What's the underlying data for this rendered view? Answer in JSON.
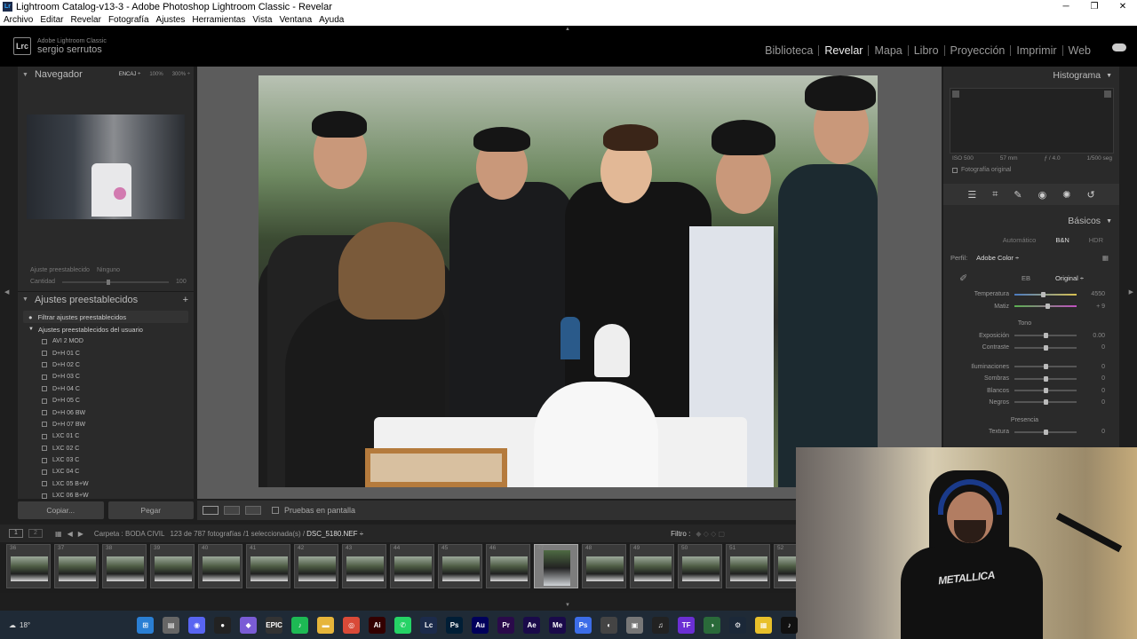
{
  "window": {
    "title": "Lightroom Catalog-v13-3 - Adobe Photoshop Lightroom Classic - Revelar",
    "minimize": "─",
    "maximize": "❐",
    "close": "✕"
  },
  "menu": [
    "Archivo",
    "Editar",
    "Revelar",
    "Fotografía",
    "Ajustes",
    "Herramientas",
    "Vista",
    "Ventana",
    "Ayuda"
  ],
  "identity": {
    "badge": "Lrc",
    "product": "Adobe Lightroom Classic",
    "user": "sergio serrutos"
  },
  "modules": [
    {
      "label": "Biblioteca",
      "active": false
    },
    {
      "label": "Revelar",
      "active": true
    },
    {
      "label": "Mapa",
      "active": false
    },
    {
      "label": "Libro",
      "active": false
    },
    {
      "label": "Proyección",
      "active": false
    },
    {
      "label": "Imprimir",
      "active": false
    },
    {
      "label": "Web",
      "active": false
    }
  ],
  "navigator": {
    "title": "Navegador",
    "opt1": "ENCAJ ÷",
    "opt2": "100%",
    "opt3": "300% ÷"
  },
  "preset_info": {
    "label": "Ajuste preestablecido",
    "value": "Ninguno",
    "amount_label": "Cantidad",
    "amount_value": "100"
  },
  "presets": {
    "title": "Ajustes preestablecidos",
    "add": "+",
    "filter": "Filtrar ajustes preestablecidos",
    "group": "Ajustes preestablecidos del usuario",
    "items": [
      "AVI 2 MOD",
      "D+H 01 C",
      "D+H 02 C",
      "D+H 03 C",
      "D+H 04 C",
      "D+H 05 C",
      "D+H 06 BW",
      "D+H 07 BW",
      "LXC 01 C",
      "LXC 02 C",
      "LXC 03 C",
      "LXC 04 C",
      "LXC 05 B+W",
      "LXC 06 B+W"
    ]
  },
  "left_buttons": {
    "copy": "Copiar...",
    "paste": "Pegar"
  },
  "toolbar": {
    "proof": "Pruebas en pantalla"
  },
  "histogram": {
    "title": "Histograma",
    "iso": "ISO 500",
    "focal": "57 mm",
    "aperture": "ƒ / 4.0",
    "shutter": "1/500 seg",
    "original": "Fotografía original"
  },
  "basic": {
    "title": "Básicos",
    "treatment": [
      "Automático",
      "B&N",
      "HDR"
    ],
    "profile_label": "Perfil:",
    "profile_value": "Adobe Color ÷",
    "wb_label": "EB",
    "wb_value": "Original ÷",
    "temp": {
      "label": "Temperatura",
      "value": "4550",
      "pos": 0.45
    },
    "tint": {
      "label": "Matiz",
      "value": "+ 9",
      "pos": 0.53
    },
    "tone_label": "Tono",
    "tone": [
      {
        "label": "Exposición",
        "value": "0.00",
        "pos": 0.5
      },
      {
        "label": "Contraste",
        "value": "0",
        "pos": 0.5
      }
    ],
    "tone2": [
      {
        "label": "Iluminaciones",
        "value": "0",
        "pos": 0.5
      },
      {
        "label": "Sombras",
        "value": "0",
        "pos": 0.5
      },
      {
        "label": "Blancos",
        "value": "0",
        "pos": 0.5
      },
      {
        "label": "Negros",
        "value": "0",
        "pos": 0.5
      }
    ],
    "presence_label": "Presencia",
    "texture": {
      "label": "Textura",
      "value": "0",
      "pos": 0.5
    }
  },
  "filmbar": {
    "screen1": "1",
    "screen2": "2",
    "folder": "Carpeta : BODA CIVIL",
    "count": "123 de 787 fotografías /1 seleccionada(s) /",
    "file": "DSC_5180.NEF ÷",
    "filter": "Filtro :"
  },
  "filmstrip": [
    "36",
    "37",
    "38",
    "39",
    "40",
    "41",
    "42",
    "43",
    "44",
    "45",
    "46",
    "47",
    "48",
    "49",
    "50",
    "51",
    "52"
  ],
  "selected_frame": "47",
  "taskbar": {
    "temp": "18°",
    "apps": [
      {
        "name": "windows",
        "label": "⊞",
        "color": "#2a7fd4"
      },
      {
        "name": "explorer-files",
        "label": "▤",
        "color": "#666"
      },
      {
        "name": "discord",
        "label": "◉",
        "color": "#5865f2"
      },
      {
        "name": "obs",
        "label": "●",
        "color": "#222"
      },
      {
        "name": "copilot",
        "label": "◆",
        "color": "#7a5cd6"
      },
      {
        "name": "epic",
        "label": "EPIC",
        "color": "#333"
      },
      {
        "name": "spotify",
        "label": "♪",
        "color": "#1db954"
      },
      {
        "name": "folder",
        "label": "▬",
        "color": "#e6b53a"
      },
      {
        "name": "chrome",
        "label": "◎",
        "color": "#d94a38"
      },
      {
        "name": "illustrator",
        "label": "Ai",
        "color": "#330000"
      },
      {
        "name": "whatsapp",
        "label": "✆",
        "color": "#25d366"
      },
      {
        "name": "lightroom",
        "label": "Lc",
        "color": "#1c2b4b"
      },
      {
        "name": "photoshop",
        "label": "Ps",
        "color": "#001e36"
      },
      {
        "name": "audition",
        "label": "Au",
        "color": "#00005b"
      },
      {
        "name": "premiere",
        "label": "Pr",
        "color": "#2a0a4a"
      },
      {
        "name": "after-effects",
        "label": "Ae",
        "color": "#1a0a4a"
      },
      {
        "name": "media-encoder",
        "label": "Me",
        "color": "#1a0a4a"
      },
      {
        "name": "ps-express",
        "label": "Ps",
        "color": "#3c6de8"
      },
      {
        "name": "steam-dl",
        "label": "◐",
        "color": "#444"
      },
      {
        "name": "pdf",
        "label": "▣",
        "color": "#777"
      },
      {
        "name": "tiktok-studio",
        "label": "♫",
        "color": "#222"
      },
      {
        "name": "tf",
        "label": "TF",
        "color": "#6b2fd4"
      },
      {
        "name": "app-green",
        "label": "◑",
        "color": "#2a6a3a"
      },
      {
        "name": "steam",
        "label": "⚙",
        "color": "#1b2838"
      },
      {
        "name": "sticky",
        "label": "▦",
        "color": "#e8c02a"
      },
      {
        "name": "tiktok",
        "label": "♪",
        "color": "#111"
      }
    ]
  },
  "webcam": {
    "shirt": "METALLICA"
  }
}
